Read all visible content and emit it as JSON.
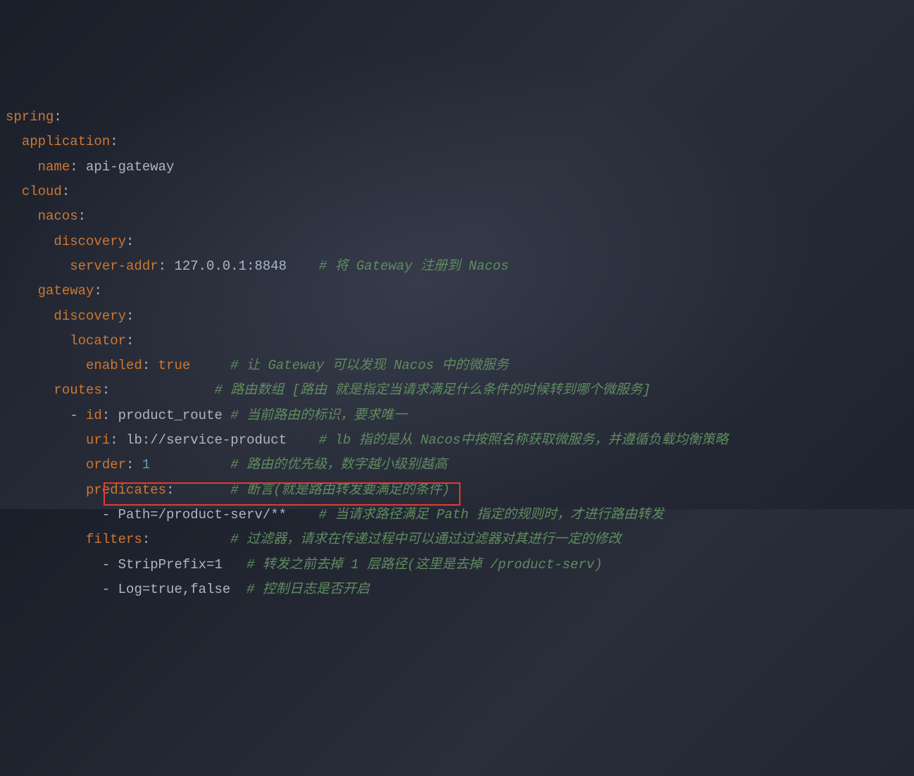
{
  "code": {
    "l1": {
      "key": "spring",
      "colon": ":"
    },
    "l2": {
      "indent": "  ",
      "key": "application",
      "colon": ":"
    },
    "l3": {
      "indent": "    ",
      "key": "name",
      "colon": ": ",
      "value": "api-gateway"
    },
    "l4": {
      "indent": "  ",
      "key": "cloud",
      "colon": ":"
    },
    "l5": {
      "indent": "    ",
      "key": "nacos",
      "colon": ":"
    },
    "l6": {
      "indent": "      ",
      "key": "discovery",
      "colon": ":"
    },
    "l7": {
      "indent": "        ",
      "key": "server-addr",
      "colon": ": ",
      "value": "127.0.0.1:8848",
      "space": "    ",
      "comment": "# 将 Gateway 注册到 Nacos"
    },
    "l8": {
      "indent": "    ",
      "key": "gateway",
      "colon": ":"
    },
    "l9": {
      "indent": "      ",
      "key": "discovery",
      "colon": ":"
    },
    "l10": {
      "indent": "        ",
      "key": "locator",
      "colon": ":"
    },
    "l11": {
      "indent": "          ",
      "key": "enabled",
      "colon": ": ",
      "value": "true",
      "space": "     ",
      "comment": "# 让 Gateway 可以发现 Nacos 中的微服务"
    },
    "l12": {
      "indent": "      ",
      "key": "routes",
      "colon": ":",
      "space": "             ",
      "comment": "# 路由数组 [路由 就是指定当请求满足什么条件的时候转到哪个微服务]"
    },
    "l13": {
      "indent": "        ",
      "dash": "- ",
      "key": "id",
      "colon": ": ",
      "value": "product_route",
      "space": " ",
      "comment": "# 当前路由的标识，要求唯一"
    },
    "l14": {
      "indent": "          ",
      "key": "uri",
      "colon": ": ",
      "value": "lb://service-product",
      "space": "    ",
      "comment": "# lb 指的是从 Nacos中按照名称获取微服务，并遵循负载均衡策略"
    },
    "l15": {
      "indent": "          ",
      "key": "order",
      "colon": ": ",
      "value": "1",
      "space": "          ",
      "comment": "# 路由的优先级，数字越小级别越高"
    },
    "l16": {
      "indent": "          ",
      "key": "predicates",
      "colon": ":",
      "space": "       ",
      "comment": "# 断言(就是路由转发要满足的条件)"
    },
    "l17": {
      "indent": "            ",
      "dash": "- ",
      "value": "Path=/product-serv/**",
      "space": "    ",
      "comment": "# 当请求路径满足 Path 指定的规则时，才进行路由转发"
    },
    "l18": {
      "indent": "          ",
      "key": "filters",
      "colon": ":",
      "space": "          ",
      "comment": "# 过滤器，请求在传递过程中可以通过过滤器对其进行一定的修改"
    },
    "l19": {
      "indent": "            ",
      "dash": "- ",
      "value": "StripPrefix=1",
      "space": "   ",
      "comment": "# 转发之前去掉 1 层路径(这里是去掉 /product-serv)"
    },
    "l20": {
      "indent": "            ",
      "dash": "- ",
      "value": "Log=true,false",
      "space": "  ",
      "comment": "# 控制日志是否开启"
    }
  }
}
